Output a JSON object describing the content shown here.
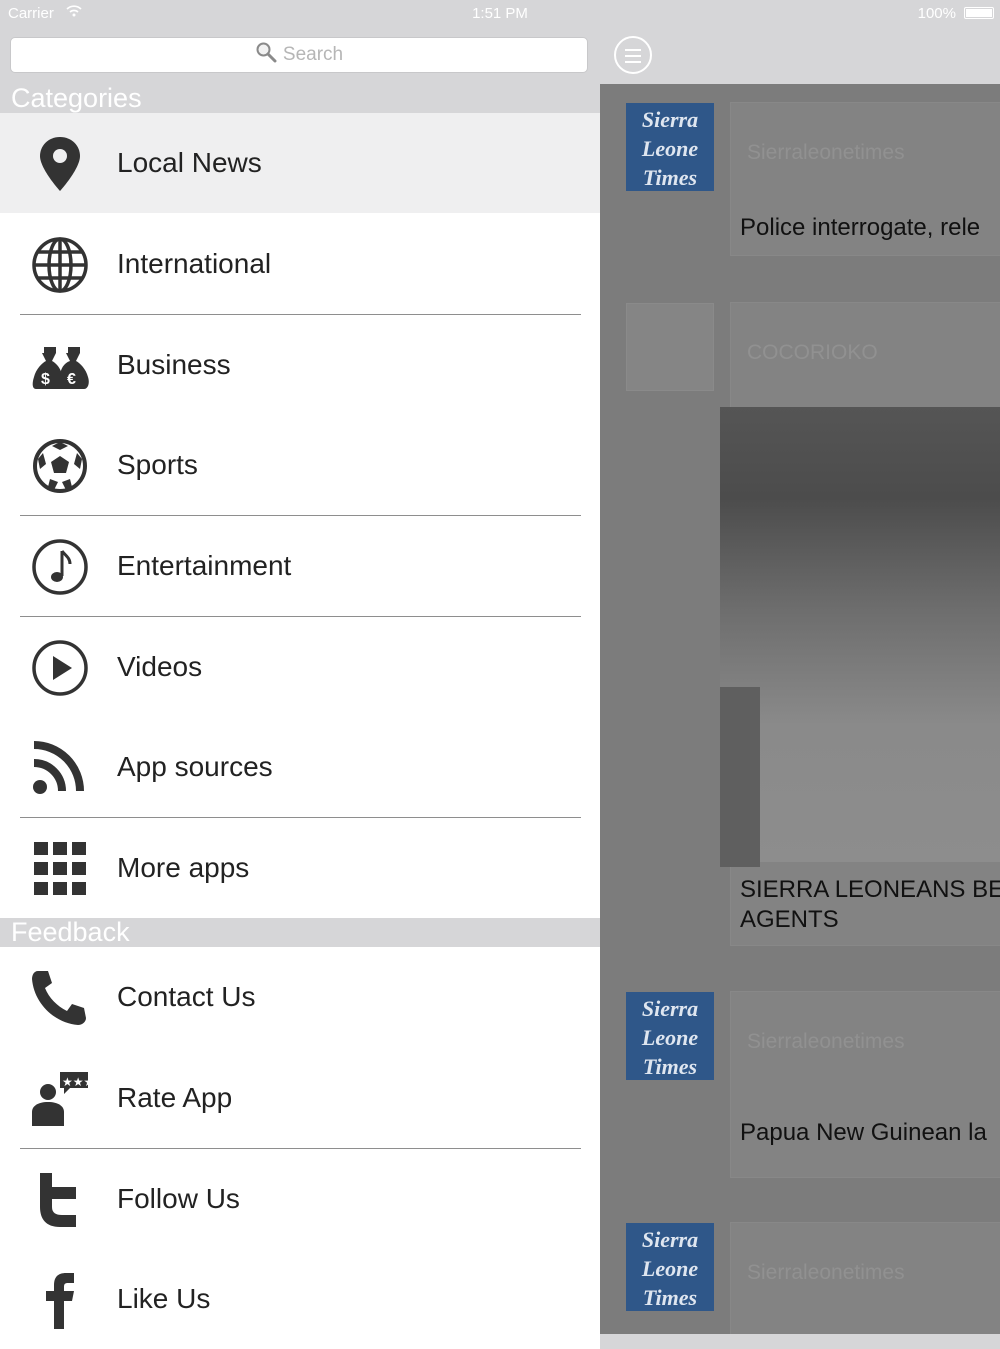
{
  "status_bar": {
    "carrier": "Carrier",
    "time": "1:51 PM",
    "battery": "100%"
  },
  "search": {
    "placeholder": "Search"
  },
  "sections": {
    "categories": "Categories",
    "feedback": "Feedback"
  },
  "categories": [
    {
      "label": "Local News",
      "icon": "location-pin-icon"
    },
    {
      "label": "International",
      "icon": "globe-icon"
    },
    {
      "label": "Business",
      "icon": "money-bags-icon"
    },
    {
      "label": "Sports",
      "icon": "soccer-ball-icon"
    },
    {
      "label": "Entertainment",
      "icon": "music-note-icon"
    },
    {
      "label": "Videos",
      "icon": "play-icon"
    },
    {
      "label": "App sources",
      "icon": "rss-icon"
    },
    {
      "label": "More apps",
      "icon": "grid-icon"
    }
  ],
  "feedback": [
    {
      "label": "Contact Us",
      "icon": "phone-icon"
    },
    {
      "label": "Rate App",
      "icon": "rate-person-icon"
    },
    {
      "label": "Follow Us",
      "icon": "twitter-icon"
    },
    {
      "label": "Like Us",
      "icon": "facebook-icon"
    }
  ],
  "feed": [
    {
      "thumb_text": "Sierra Leone Times",
      "source": "Sierraleonetimes",
      "headline": "Police interrogate, rele"
    },
    {
      "thumb_text": "",
      "source": "COCORIOKO",
      "headline_line1": "SIERRA LEONEANS BE",
      "headline_line2": "AGENTS"
    },
    {
      "thumb_text": "Sierra Leone Times",
      "source": "Sierraleonetimes",
      "headline": "Papua New Guinean la"
    },
    {
      "thumb_text": "Sierra Leone Times",
      "source": "Sierraleonetimes",
      "headline": ""
    }
  ],
  "thumb_lines": [
    "Sierra",
    "Leone",
    "Times"
  ]
}
